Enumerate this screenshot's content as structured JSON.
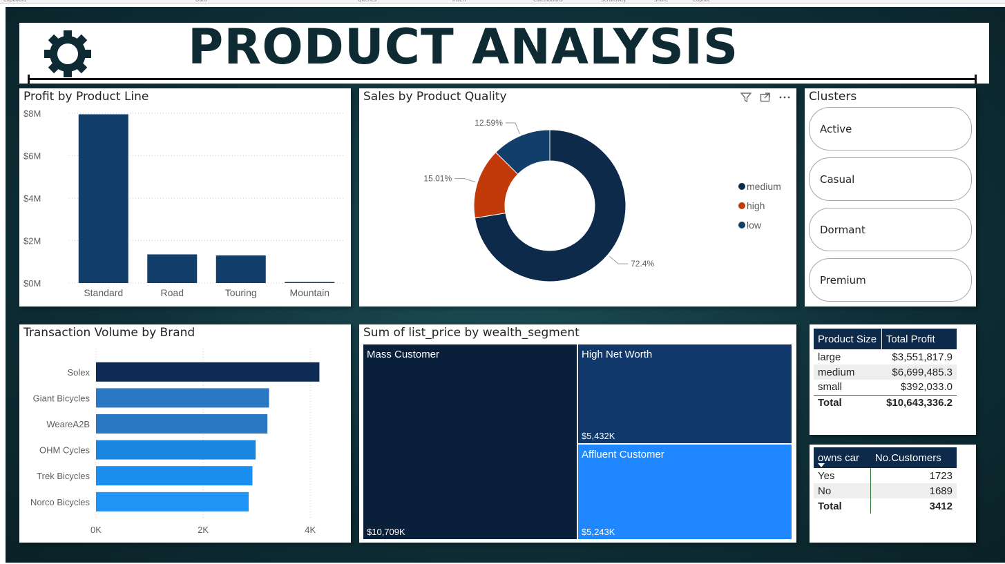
{
  "page": {
    "title": "PRODUCT ANALYSIS",
    "ribbon_labels": [
      "Clipboard",
      "Data",
      "Queries",
      "Insert",
      "Calculations",
      "Sensitivity",
      "Share",
      "Copilot"
    ]
  },
  "colors": {
    "dark_navy": "#0e2a4a",
    "navy": "#123e6b",
    "orange": "#c23a0a",
    "treemap_dark": "#0a1f3a",
    "treemap_mid": "#10386a",
    "treemap_bright": "#1f87ff",
    "bar_blues": [
      "#0d2b55",
      "#2a78c4",
      "#2a78c4",
      "#1a86e0",
      "#1a8ff0",
      "#1e95f5"
    ]
  },
  "profit_by_line": {
    "title": "Profit by Product Line",
    "chart_data": {
      "type": "bar",
      "categories": [
        "Standard",
        "Road",
        "Touring",
        "Mountain"
      ],
      "values": [
        7.95,
        1.35,
        1.3,
        0.05
      ],
      "ylim": [
        0,
        8
      ],
      "yticks": [
        "$0M",
        "$2M",
        "$4M",
        "$6M",
        "$8M"
      ]
    }
  },
  "sales_by_quality": {
    "title": "Sales by Product Quality",
    "chart_data": {
      "type": "pie",
      "series": [
        {
          "name": "medium",
          "value": 72.4,
          "label": "72.4%",
          "color": "#0e2a4a"
        },
        {
          "name": "high",
          "value": 15.01,
          "label": "15.01%",
          "color": "#c23a0a"
        },
        {
          "name": "low",
          "value": 12.59,
          "label": "12.59%",
          "color": "#123e6b"
        }
      ]
    },
    "legend": [
      "medium",
      "high",
      "low"
    ],
    "icons": [
      "filter-icon",
      "focus-mode-icon",
      "more-options-icon"
    ]
  },
  "clusters": {
    "title": "Clusters",
    "items": [
      "Active",
      "Casual",
      "Dormant",
      "Premium"
    ]
  },
  "transactions_by_brand": {
    "title": "Transaction Volume by Brand",
    "chart_data": {
      "type": "bar",
      "orientation": "horizontal",
      "categories": [
        "Solex",
        "Giant Bicycles",
        "WeareA2B",
        "OHM Cycles",
        "Trek Bicycles",
        "Norco Bicycles"
      ],
      "values": [
        4170,
        3230,
        3200,
        2980,
        2920,
        2850
      ],
      "xlim": [
        0,
        4500
      ],
      "xticks": [
        "0K",
        "2K",
        "4K"
      ]
    }
  },
  "wealth_treemap": {
    "title": "Sum of list_price by wealth_segment",
    "chart_data": {
      "type": "treemap",
      "series": [
        {
          "name": "Mass Customer",
          "value": 10709,
          "label": "$10,709K"
        },
        {
          "name": "High Net Worth",
          "value": 5432,
          "label": "$5,432K"
        },
        {
          "name": "Affluent Customer",
          "value": 5243,
          "label": "$5,243K"
        }
      ]
    }
  },
  "size_table": {
    "headers": [
      "Product Size",
      "Total Profit"
    ],
    "rows": [
      [
        "large",
        "$3,551,817.9"
      ],
      [
        "medium",
        "$6,699,485.3"
      ],
      [
        "small",
        "$392,033.0"
      ]
    ],
    "total": [
      "Total",
      "$10,643,336.2"
    ]
  },
  "car_table": {
    "headers": [
      "owns car",
      "No.Customers"
    ],
    "rows": [
      [
        "Yes",
        "1723"
      ],
      [
        "No",
        "1689"
      ]
    ],
    "total": [
      "Total",
      "3412"
    ]
  }
}
